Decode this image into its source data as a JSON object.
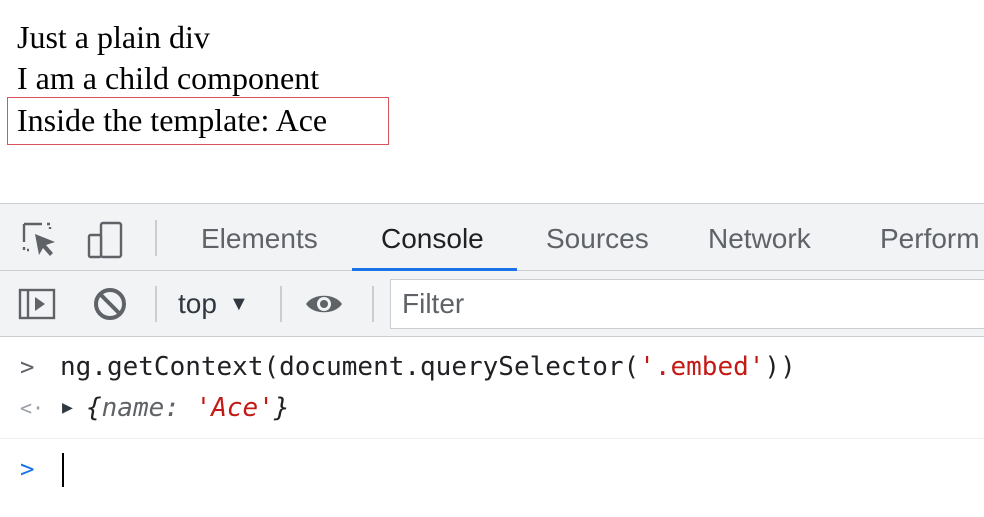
{
  "page": {
    "lines": [
      "Just a plain div",
      "I am a child component",
      "Inside the template: Ace"
    ]
  },
  "devtools": {
    "tabs": [
      {
        "label": "Elements"
      },
      {
        "label": "Console"
      },
      {
        "label": "Sources"
      },
      {
        "label": "Network"
      },
      {
        "label": "Perform"
      }
    ],
    "active_tab": "Console",
    "toolbar": {
      "context": "top",
      "filter_placeholder": "Filter"
    },
    "console": {
      "input_prefix": "ng.getContext(document.querySelector(",
      "input_string": "'.embed'",
      "input_suffix": "))",
      "result_open": "{",
      "result_key": "name:",
      "result_value": "'Ace'",
      "result_close": "}"
    }
  },
  "colors": {
    "accent": "#1a73e8",
    "highlight_border": "#d9535b",
    "string": "#c41a16"
  }
}
